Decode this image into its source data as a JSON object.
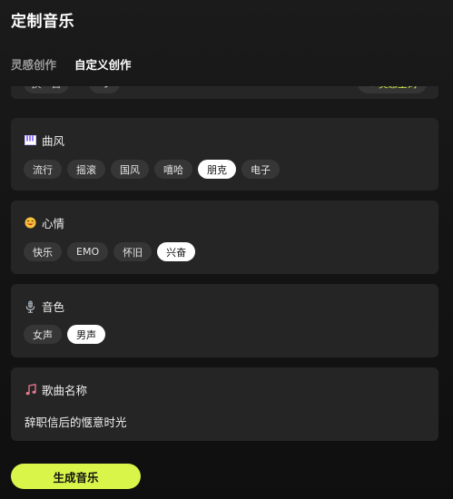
{
  "header": {
    "title": "定制音乐"
  },
  "tabs": [
    {
      "label": "灵感创作",
      "active": false
    },
    {
      "label": "自定义创作",
      "active": true
    }
  ],
  "lyrics_toolbar": {
    "change_label": "换一首",
    "insp_label": "✦ 灵感生词"
  },
  "style": {
    "label": "曲风",
    "icon": "piano-icon",
    "options": [
      "流行",
      "摇滚",
      "国风",
      "嘻哈",
      "朋克",
      "电子"
    ],
    "selected": "朋克"
  },
  "mood": {
    "label": "心情",
    "icon": "smile-emoji-icon",
    "options": [
      "快乐",
      "EMO",
      "怀旧",
      "兴奋"
    ],
    "selected": "兴奋"
  },
  "voice": {
    "label": "音色",
    "icon": "microphone-icon",
    "options": [
      "女声",
      "男声"
    ],
    "selected": "男声"
  },
  "song": {
    "label": "歌曲名称",
    "icon": "music-note-icon",
    "name": "辞职信后的惬意时光"
  },
  "generate_label": "生成音乐",
  "colors": {
    "accent": "#d9f54a",
    "card": "#252525",
    "chip": "#363636"
  }
}
